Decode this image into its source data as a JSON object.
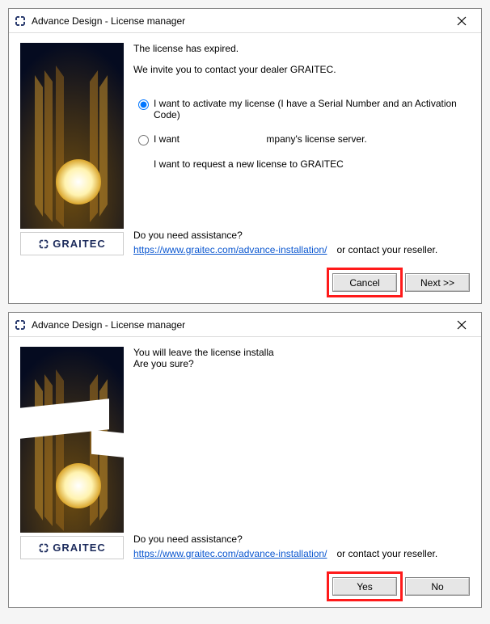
{
  "dialog1": {
    "title": "Advance Design - License manager",
    "intro1": "The license  has expired.",
    "intro2": "We invite you to contact your dealer GRAITEC.",
    "radios": {
      "opt1": "I want to activate my license (I have a Serial Number and an Activation Code)",
      "opt2_pre": "I want ",
      "opt2_post": "mpany's license server.",
      "opt3_post": "I want to request a new license to GRAITEC"
    },
    "assist_q": "Do you need assistance?",
    "assist_link": "https://www.graitec.com/advance-installation/",
    "assist_after": "or contact your reseller.",
    "btn_cancel": "Cancel",
    "btn_next": "Next >>"
  },
  "dialog2": {
    "title": "Advance Design - License manager",
    "msg_line1": "You will leave the license installa",
    "msg_line2": "Are you sure?",
    "assist_q": "Do you need assistance?",
    "assist_link": "https://www.graitec.com/advance-installation/",
    "assist_after": "or contact your reseller.",
    "btn_yes": "Yes",
    "btn_no": "No"
  },
  "brand": "GRAITEC"
}
